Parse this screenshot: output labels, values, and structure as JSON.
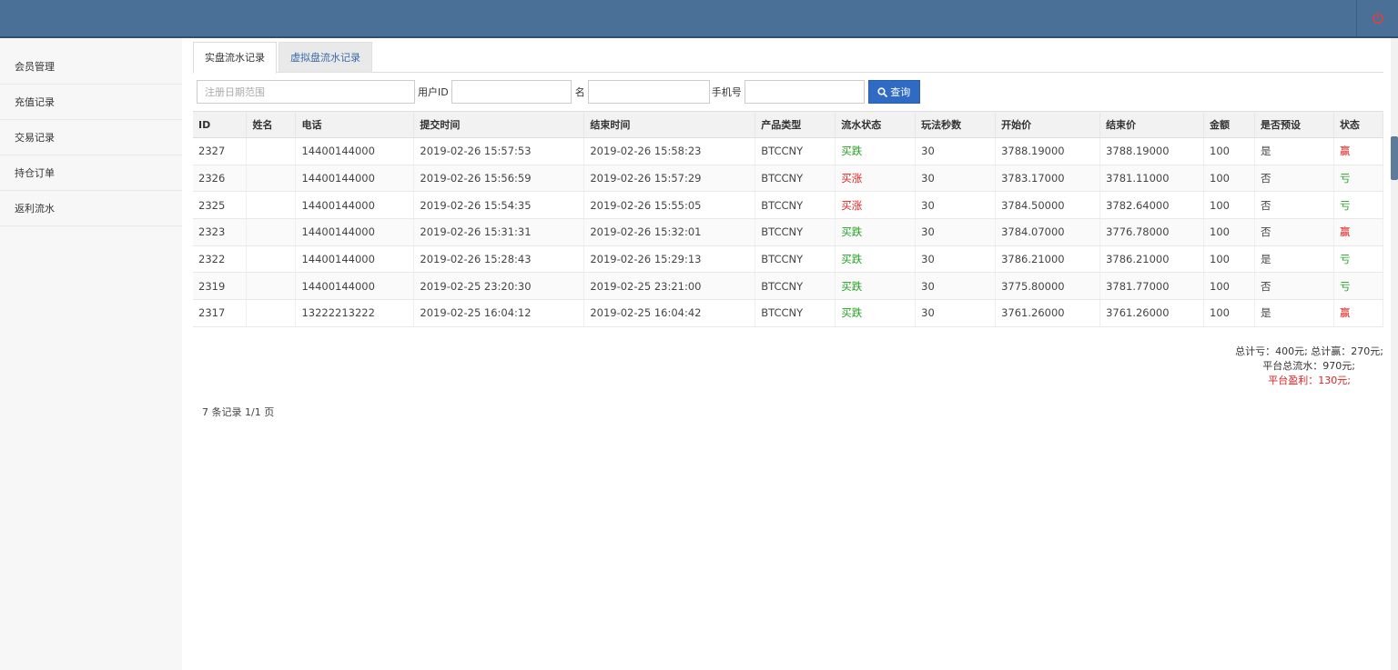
{
  "header": {
    "power_icon": "power-icon"
  },
  "sidebar": {
    "items": [
      {
        "label": "会员管理"
      },
      {
        "label": "充值记录"
      },
      {
        "label": "交易记录"
      },
      {
        "label": "持仓订单"
      },
      {
        "label": "返利流水"
      }
    ]
  },
  "tabs": [
    {
      "label": "实盘流水记录"
    },
    {
      "label": "虚拟盘流水记录"
    }
  ],
  "search": {
    "date_placeholder": "注册日期范围",
    "userid_label": "用户ID",
    "name_label": "名",
    "phone_label": "手机号",
    "query_label": "查询"
  },
  "table": {
    "headers": [
      "ID",
      "姓名",
      "电话",
      "提交时间",
      "结束时间",
      "产品类型",
      "流水状态",
      "玩法秒数",
      "开始价",
      "结束价",
      "金额",
      "是否预设",
      "状态"
    ],
    "rows": [
      [
        "2327",
        "",
        "14400144000",
        "2019-02-26 15:57:53",
        "2019-02-26 15:58:23",
        "BTCCNY",
        "买跌",
        "30",
        "3788.19000",
        "3788.19000",
        "100",
        "是",
        "赢"
      ],
      [
        "2326",
        "",
        "14400144000",
        "2019-02-26 15:56:59",
        "2019-02-26 15:57:29",
        "BTCCNY",
        "买涨",
        "30",
        "3783.17000",
        "3781.11000",
        "100",
        "否",
        "亏"
      ],
      [
        "2325",
        "",
        "14400144000",
        "2019-02-26 15:54:35",
        "2019-02-26 15:55:05",
        "BTCCNY",
        "买涨",
        "30",
        "3784.50000",
        "3782.64000",
        "100",
        "否",
        "亏"
      ],
      [
        "2323",
        "",
        "14400144000",
        "2019-02-26 15:31:31",
        "2019-02-26 15:32:01",
        "BTCCNY",
        "买跌",
        "30",
        "3784.07000",
        "3776.78000",
        "100",
        "否",
        "赢"
      ],
      [
        "2322",
        "",
        "14400144000",
        "2019-02-26 15:28:43",
        "2019-02-26 15:29:13",
        "BTCCNY",
        "买跌",
        "30",
        "3786.21000",
        "3786.21000",
        "100",
        "是",
        "亏"
      ],
      [
        "2319",
        "",
        "14400144000",
        "2019-02-25 23:20:30",
        "2019-02-25 23:21:00",
        "BTCCNY",
        "买跌",
        "30",
        "3775.80000",
        "3781.77000",
        "100",
        "否",
        "亏"
      ],
      [
        "2317",
        "",
        "13222213222",
        "2019-02-25 16:04:12",
        "2019-02-25 16:04:42",
        "BTCCNY",
        "买跌",
        "30",
        "3761.26000",
        "3761.26000",
        "100",
        "是",
        "赢"
      ]
    ]
  },
  "summary": {
    "line1": "总计亏：400元; 总计赢：270元;",
    "line2": "平台总流水：970元;",
    "line3": "平台盈利：130元;"
  },
  "pager": {
    "text": "7 条记录 1/1 页"
  },
  "colors": {
    "header_bg": "#4a7097",
    "buy_down": "#21a021",
    "buy_up": "#e02020",
    "win": "#e02020",
    "loss": "#21a021",
    "query_btn": "#2f6bc3"
  }
}
